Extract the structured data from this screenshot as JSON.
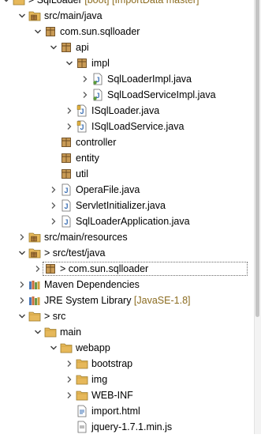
{
  "colors": {
    "folder": "#e6b85a",
    "package": "#a8773a",
    "java": "#3a6fb5",
    "decorator": "#8b6b1f"
  },
  "tree": [
    {
      "name": "project-sqlloader",
      "twisty": "expanded",
      "icon": "project-icon",
      "label": "> SqlLoader",
      "suffix": " [boot] [ImportData master]",
      "depth": 0
    },
    {
      "name": "folder-src-main-java",
      "twisty": "expanded",
      "icon": "source-folder-icon",
      "label": "src/main/java",
      "suffix": "",
      "depth": 1
    },
    {
      "name": "package-com-sun-sqlloader",
      "twisty": "expanded",
      "icon": "package-icon",
      "label": "com.sun.sqlloader",
      "suffix": "",
      "depth": 2
    },
    {
      "name": "package-api",
      "twisty": "expanded",
      "icon": "package-icon",
      "label": "api",
      "suffix": "",
      "depth": 3
    },
    {
      "name": "package-impl",
      "twisty": "expanded",
      "icon": "package-icon",
      "label": "impl",
      "suffix": "",
      "depth": 4
    },
    {
      "name": "file-sqlloaderimpl",
      "twisty": "collapsed",
      "icon": "java-class-icon",
      "label": "SqlLoaderImpl.java",
      "suffix": "",
      "depth": 5
    },
    {
      "name": "file-sqlloadserviceimpl",
      "twisty": "collapsed",
      "icon": "java-class-icon",
      "label": "SqlLoadServiceImpl.java",
      "suffix": "",
      "depth": 5
    },
    {
      "name": "file-isqlloader",
      "twisty": "collapsed",
      "icon": "java-interface-icon",
      "label": "ISqlLoader.java",
      "suffix": "",
      "depth": 4
    },
    {
      "name": "file-isqlloadservice",
      "twisty": "collapsed",
      "icon": "java-interface-icon",
      "label": "ISqlLoadService.java",
      "suffix": "",
      "depth": 4
    },
    {
      "name": "package-controller",
      "twisty": "none",
      "icon": "package-icon",
      "label": "controller",
      "suffix": "",
      "depth": 3
    },
    {
      "name": "package-entity",
      "twisty": "none",
      "icon": "package-icon",
      "label": "entity",
      "suffix": "",
      "depth": 3
    },
    {
      "name": "package-util",
      "twisty": "none",
      "icon": "package-icon",
      "label": "util",
      "suffix": "",
      "depth": 3
    },
    {
      "name": "file-operafile",
      "twisty": "collapsed",
      "icon": "java-file-icon",
      "label": "OperaFile.java",
      "suffix": "",
      "depth": 3
    },
    {
      "name": "file-servletinitializer",
      "twisty": "collapsed",
      "icon": "java-file-icon",
      "label": "ServletInitializer.java",
      "suffix": "",
      "depth": 3
    },
    {
      "name": "file-sqlloaderapplication",
      "twisty": "collapsed",
      "icon": "java-file-icon",
      "label": "SqlLoaderApplication.java",
      "suffix": "",
      "depth": 3
    },
    {
      "name": "folder-src-main-resources",
      "twisty": "collapsed",
      "icon": "source-folder-icon",
      "label": "src/main/resources",
      "suffix": "",
      "depth": 1
    },
    {
      "name": "folder-src-test-java",
      "twisty": "expanded",
      "icon": "source-folder-icon",
      "label": "> src/test/java",
      "suffix": "",
      "depth": 1
    },
    {
      "name": "package-test-com-sun-sqlloader",
      "twisty": "collapsed",
      "icon": "package-icon",
      "label": "> com.sun.sqlloader",
      "suffix": "",
      "depth": 2,
      "selected": true
    },
    {
      "name": "library-maven-dependencies",
      "twisty": "collapsed",
      "icon": "library-icon",
      "label": "Maven Dependencies",
      "suffix": "",
      "depth": 1
    },
    {
      "name": "library-jre-system",
      "twisty": "collapsed",
      "icon": "library-icon",
      "label": "JRE System Library",
      "suffix": " [JavaSE-1.8]",
      "depth": 1
    },
    {
      "name": "folder-src",
      "twisty": "expanded",
      "icon": "folder-icon",
      "label": "> src",
      "suffix": "",
      "depth": 1
    },
    {
      "name": "folder-main",
      "twisty": "expanded",
      "icon": "folder-icon",
      "label": "main",
      "suffix": "",
      "depth": 2
    },
    {
      "name": "folder-webapp",
      "twisty": "expanded",
      "icon": "folder-icon",
      "label": "webapp",
      "suffix": "",
      "depth": 3
    },
    {
      "name": "folder-bootstrap",
      "twisty": "collapsed",
      "icon": "folder-icon",
      "label": "bootstrap",
      "suffix": "",
      "depth": 4
    },
    {
      "name": "folder-img",
      "twisty": "collapsed",
      "icon": "folder-icon",
      "label": "img",
      "suffix": "",
      "depth": 4
    },
    {
      "name": "folder-web-inf",
      "twisty": "collapsed",
      "icon": "folder-icon",
      "label": "WEB-INF",
      "suffix": "",
      "depth": 4
    },
    {
      "name": "file-import-html",
      "twisty": "none",
      "icon": "html-file-icon",
      "label": "import.html",
      "suffix": "",
      "depth": 4
    },
    {
      "name": "file-jquery",
      "twisty": "none",
      "icon": "js-file-icon",
      "label": "jquery-1.7.1.min.js",
      "suffix": "",
      "depth": 4
    }
  ]
}
